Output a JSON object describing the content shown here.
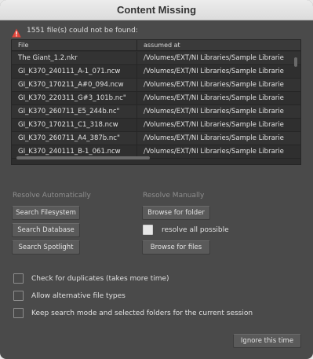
{
  "window": {
    "title": "Content Missing"
  },
  "warning": {
    "icon": "warning-triangle-icon",
    "text": "1551 file(s) could not be found:",
    "color": "#e0453a"
  },
  "table": {
    "columns": [
      "File",
      "assumed at"
    ],
    "rows": [
      {
        "file": "The Giant_1.2.nkr",
        "path": "/Volumes/EXT/NI Libraries/Sample Librarie"
      },
      {
        "file": "GI_K370_240111_A-1_071.ncw",
        "path": "/Volumes/EXT/NI Libraries/Sample Librarie"
      },
      {
        "file": "GI_K370_170211_A#0_094.ncw",
        "path": "/Volumes/EXT/NI Libraries/Sample Librarie"
      },
      {
        "file": "GI_K370_220311_G#3_101b.nc\"",
        "path": "/Volumes/EXT/NI Libraries/Sample Librarie"
      },
      {
        "file": "GI_K370_260711_E5_244b.nc\"",
        "path": "/Volumes/EXT/NI Libraries/Sample Librarie"
      },
      {
        "file": "GI_K370_170211_C1_318.ncw",
        "path": "/Volumes/EXT/NI Libraries/Sample Librarie"
      },
      {
        "file": "GI_K370_260711_A4_387b.nc\"",
        "path": "/Volumes/EXT/NI Libraries/Sample Librarie"
      },
      {
        "file": "GI_K370_240111_B-1_061.ncw",
        "path": "/Volumes/EXT/NI Libraries/Sample Librarie"
      }
    ]
  },
  "resolve_auto": {
    "heading": "Resolve Automatically",
    "buttons": [
      "Search Filesystem",
      "Search Database",
      "Search Spotlight"
    ]
  },
  "resolve_manual": {
    "heading": "Resolve Manually",
    "browse_folder": "Browse for folder",
    "resolve_all_label": "resolve all possible",
    "browse_files": "Browse for files"
  },
  "options": [
    {
      "label": "Check for duplicates (takes more time)",
      "checked": false
    },
    {
      "label": "Allow alternative file types",
      "checked": false
    },
    {
      "label": "Keep search mode and selected folders for the current session",
      "checked": false
    }
  ],
  "footer": {
    "ignore_label": "Ignore this time"
  }
}
